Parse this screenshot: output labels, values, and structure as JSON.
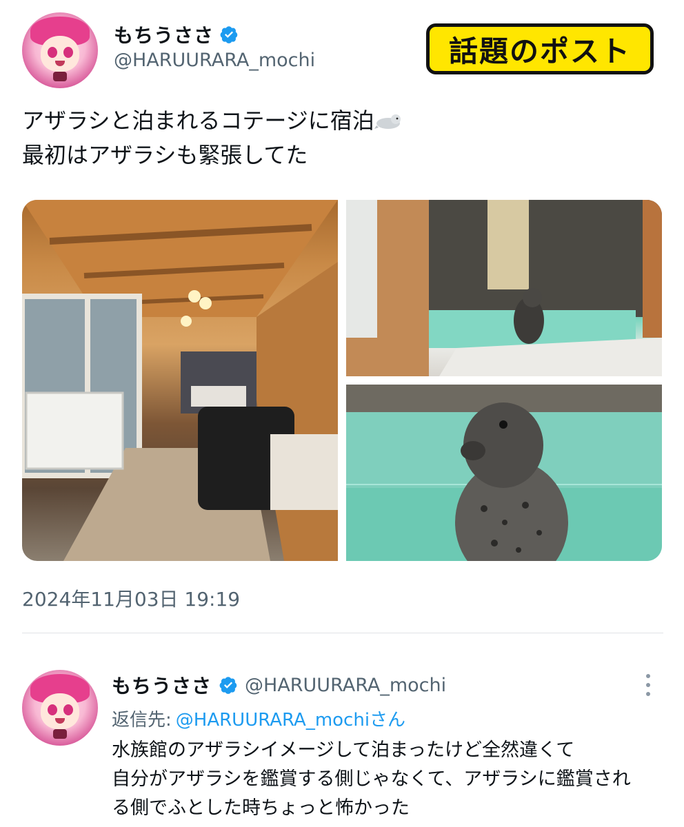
{
  "post": {
    "author_name": "もちうささ",
    "author_handle": "@HARUURARA_mochi",
    "badge_label": "話題のポスト",
    "text_lines": [
      "アザラシと泊まれるコテージに宿泊",
      "最初はアザラシも緊張してた"
    ],
    "emoji": "seal-emoji",
    "timestamp": "2024年11月03日 19:19"
  },
  "reply": {
    "author_name": "もちうささ",
    "author_handle": "@HARUURARA_mochi",
    "reply_to_label": "返信先:",
    "reply_to_handle": "@HARUURARA_mochiさん",
    "text_lines": [
      "水族館のアザラシイメージして泊まったけど全然違くて",
      "自分がアザラシを鑑賞する側じゃなくて、アザラシに鑑賞され",
      "る側でふとした時ちょっと怖かった"
    ]
  },
  "colors": {
    "verified": "#1d9bf0",
    "badge_bg": "#ffe600",
    "link": "#1d9bf0",
    "secondary_text": "#536471"
  },
  "icons": [
    "verified-badge-icon",
    "more-options-icon"
  ]
}
